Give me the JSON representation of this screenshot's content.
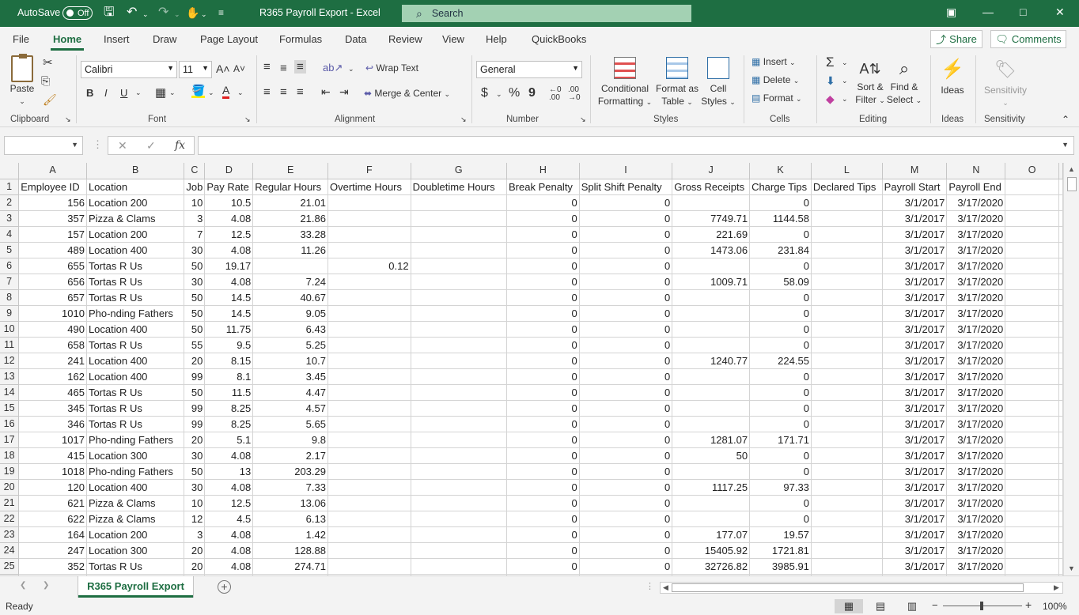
{
  "titlebar": {
    "autosave_label": "AutoSave",
    "autosave_state": "Off",
    "title": "R365 Payroll Export - Excel",
    "search_placeholder": "Search",
    "icons": [
      "save-icon",
      "undo-icon",
      "redo-icon",
      "touch-mode-icon",
      "customize-icon"
    ]
  },
  "menu": {
    "items": [
      "File",
      "Home",
      "Insert",
      "Draw",
      "Page Layout",
      "Formulas",
      "Data",
      "Review",
      "View",
      "Help",
      "QuickBooks"
    ],
    "active": "Home",
    "share_label": "Share",
    "comments_label": "Comments"
  },
  "ribbon": {
    "clipboard": {
      "paste": "Paste",
      "label": "Clipboard"
    },
    "font": {
      "name": "Calibri",
      "size": "11",
      "label": "Font",
      "bold": "B",
      "italic": "I",
      "underline": "U"
    },
    "alignment": {
      "wrap": "Wrap Text",
      "merge": "Merge & Center",
      "label": "Alignment"
    },
    "number": {
      "format": "General",
      "label": "Number",
      "currency": "$",
      "percent": "%",
      "comma": "9"
    },
    "styles": {
      "conditional": [
        "Conditional",
        "Formatting"
      ],
      "format_table": [
        "Format as",
        "Table"
      ],
      "cell_styles": [
        "Cell",
        "Styles"
      ],
      "label": "Styles"
    },
    "cells": {
      "insert": "Insert",
      "delete": "Delete",
      "format": "Format",
      "label": "Cells"
    },
    "editing": {
      "sort": [
        "Sort &",
        "Filter"
      ],
      "find": [
        "Find &",
        "Select"
      ],
      "label": "Editing"
    },
    "ideas": {
      "button": "Ideas",
      "label": "Ideas"
    },
    "sensitivity": {
      "button": "Sensitivity",
      "label": "Sensitivity"
    }
  },
  "formula_bar": {
    "name_box": "",
    "fx": "fx",
    "formula": ""
  },
  "sheet": {
    "columns": [
      "A",
      "B",
      "C",
      "D",
      "E",
      "F",
      "G",
      "H",
      "I",
      "J",
      "K",
      "L",
      "M",
      "N",
      "O"
    ],
    "headers": [
      "Employee ID",
      "Location",
      "Job",
      "Pay Rate",
      "Regular Hours",
      "Overtime Hours",
      "Doubletime Hours",
      "Break Penalty",
      "Split Shift Penalty",
      "Gross Receipts",
      "Charge Tips",
      "Declared Tips",
      "Payroll Start",
      "Payroll End",
      ""
    ],
    "rows": [
      [
        "156",
        "Location 200",
        "10",
        "10.5",
        "21.01",
        "",
        "",
        "0",
        "0",
        "",
        "0",
        "",
        "3/1/2017",
        "3/17/2020",
        ""
      ],
      [
        "357",
        "Pizza & Clams",
        "3",
        "4.08",
        "21.86",
        "",
        "",
        "0",
        "0",
        "7749.71",
        "1144.58",
        "",
        "3/1/2017",
        "3/17/2020",
        ""
      ],
      [
        "157",
        "Location 200",
        "7",
        "12.5",
        "33.28",
        "",
        "",
        "0",
        "0",
        "221.69",
        "0",
        "",
        "3/1/2017",
        "3/17/2020",
        ""
      ],
      [
        "489",
        "Location 400",
        "30",
        "4.08",
        "11.26",
        "",
        "",
        "0",
        "0",
        "1473.06",
        "231.84",
        "",
        "3/1/2017",
        "3/17/2020",
        ""
      ],
      [
        "655",
        "Tortas R Us",
        "50",
        "19.17",
        "",
        "0.12",
        "",
        "0",
        "0",
        "",
        "0",
        "",
        "3/1/2017",
        "3/17/2020",
        ""
      ],
      [
        "656",
        "Tortas R Us",
        "30",
        "4.08",
        "7.24",
        "",
        "",
        "0",
        "0",
        "1009.71",
        "58.09",
        "",
        "3/1/2017",
        "3/17/2020",
        ""
      ],
      [
        "657",
        "Tortas R Us",
        "50",
        "14.5",
        "40.67",
        "",
        "",
        "0",
        "0",
        "",
        "0",
        "",
        "3/1/2017",
        "3/17/2020",
        ""
      ],
      [
        "1010",
        "Pho-nding Fathers",
        "50",
        "14.5",
        "9.05",
        "",
        "",
        "0",
        "0",
        "",
        "0",
        "",
        "3/1/2017",
        "3/17/2020",
        ""
      ],
      [
        "490",
        "Location 400",
        "50",
        "11.75",
        "6.43",
        "",
        "",
        "0",
        "0",
        "",
        "0",
        "",
        "3/1/2017",
        "3/17/2020",
        ""
      ],
      [
        "658",
        "Tortas R Us",
        "55",
        "9.5",
        "5.25",
        "",
        "",
        "0",
        "0",
        "",
        "0",
        "",
        "3/1/2017",
        "3/17/2020",
        ""
      ],
      [
        "241",
        "Location 400",
        "20",
        "8.15",
        "10.7",
        "",
        "",
        "0",
        "0",
        "1240.77",
        "224.55",
        "",
        "3/1/2017",
        "3/17/2020",
        ""
      ],
      [
        "162",
        "Location 400",
        "99",
        "8.1",
        "3.45",
        "",
        "",
        "0",
        "0",
        "",
        "0",
        "",
        "3/1/2017",
        "3/17/2020",
        ""
      ],
      [
        "465",
        "Tortas R Us",
        "50",
        "11.5",
        "4.47",
        "",
        "",
        "0",
        "0",
        "",
        "0",
        "",
        "3/1/2017",
        "3/17/2020",
        ""
      ],
      [
        "345",
        "Tortas R Us",
        "99",
        "8.25",
        "4.57",
        "",
        "",
        "0",
        "0",
        "",
        "0",
        "",
        "3/1/2017",
        "3/17/2020",
        ""
      ],
      [
        "346",
        "Tortas R Us",
        "99",
        "8.25",
        "5.65",
        "",
        "",
        "0",
        "0",
        "",
        "0",
        "",
        "3/1/2017",
        "3/17/2020",
        ""
      ],
      [
        "1017",
        "Pho-nding Fathers",
        "20",
        "5.1",
        "9.8",
        "",
        "",
        "0",
        "0",
        "1281.07",
        "171.71",
        "",
        "3/1/2017",
        "3/17/2020",
        ""
      ],
      [
        "415",
        "Location 300",
        "30",
        "4.08",
        "2.17",
        "",
        "",
        "0",
        "0",
        "50",
        "0",
        "",
        "3/1/2017",
        "3/17/2020",
        ""
      ],
      [
        "1018",
        "Pho-nding Fathers",
        "50",
        "13",
        "203.29",
        "",
        "",
        "0",
        "0",
        "",
        "0",
        "",
        "3/1/2017",
        "3/17/2020",
        ""
      ],
      [
        "120",
        "Location 400",
        "30",
        "4.08",
        "7.33",
        "",
        "",
        "0",
        "0",
        "1117.25",
        "97.33",
        "",
        "3/1/2017",
        "3/17/2020",
        ""
      ],
      [
        "621",
        "Pizza & Clams",
        "10",
        "12.5",
        "13.06",
        "",
        "",
        "0",
        "0",
        "",
        "0",
        "",
        "3/1/2017",
        "3/17/2020",
        ""
      ],
      [
        "622",
        "Pizza & Clams",
        "12",
        "4.5",
        "6.13",
        "",
        "",
        "0",
        "0",
        "",
        "0",
        "",
        "3/1/2017",
        "3/17/2020",
        ""
      ],
      [
        "164",
        "Location 200",
        "3",
        "4.08",
        "1.42",
        "",
        "",
        "0",
        "0",
        "177.07",
        "19.57",
        "",
        "3/1/2017",
        "3/17/2020",
        ""
      ],
      [
        "247",
        "Location 300",
        "20",
        "4.08",
        "128.88",
        "",
        "",
        "0",
        "0",
        "15405.92",
        "1721.81",
        "",
        "3/1/2017",
        "3/17/2020",
        ""
      ],
      [
        "352",
        "Tortas R Us",
        "20",
        "4.08",
        "274.71",
        "",
        "",
        "0",
        "0",
        "32726.82",
        "3985.91",
        "",
        "3/1/2017",
        "3/17/2020",
        ""
      ]
    ]
  },
  "tabs": {
    "active": "R365 Payroll Export"
  },
  "status": {
    "ready": "Ready",
    "zoom": "100%"
  }
}
